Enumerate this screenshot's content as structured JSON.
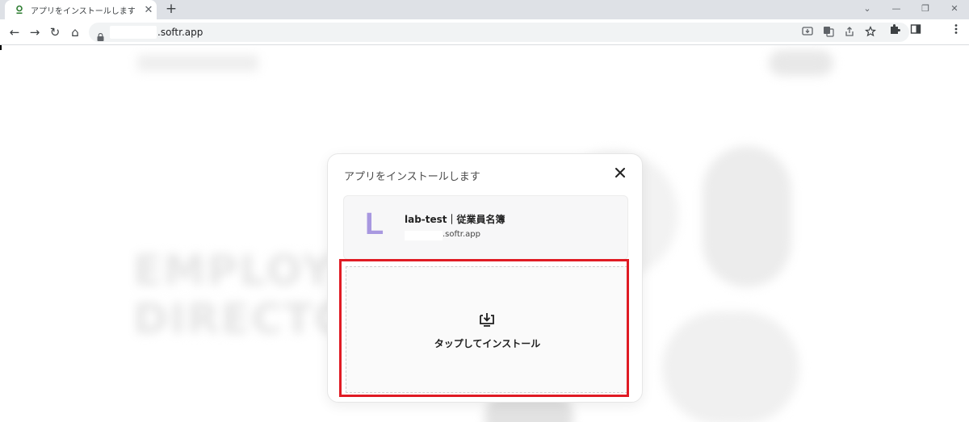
{
  "browser": {
    "tab_title": "アプリをインストールします",
    "tab_close": "✕",
    "new_tab": "+",
    "minimize": "—",
    "restore": "❐",
    "close_window": "✕",
    "chevron": "⌄",
    "url": ".softr.app"
  },
  "nav": {
    "back": "←",
    "forward": "→",
    "reload": "↻",
    "home": "⌂"
  },
  "background": {
    "headline_line1": "EMPLOYEE",
    "headline_line2": "DIRECTORY"
  },
  "dialog": {
    "title": "アプリをインストールします",
    "close": "✕",
    "app_letter": "L",
    "app_name": "lab-test｜従業員名簿",
    "app_url": ".softr.app",
    "install_label": "タップしてインストール"
  },
  "colors": {
    "highlight": "#e01b24",
    "app_letter": "#a898e0"
  }
}
